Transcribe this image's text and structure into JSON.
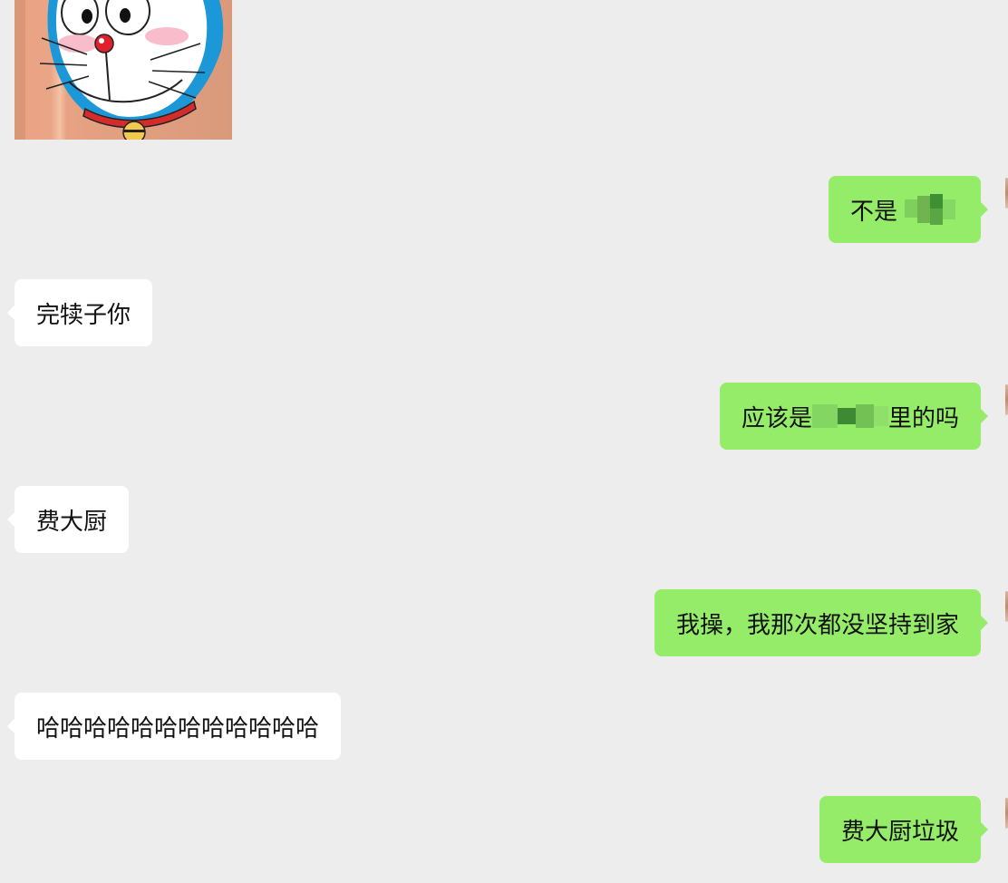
{
  "chat": {
    "sticker": {
      "alt": "doraemon-sticker"
    },
    "messages": [
      {
        "side": "right",
        "parts": [
          "不是",
          "[blurred]"
        ]
      },
      {
        "side": "left",
        "text": "完犊子你"
      },
      {
        "side": "right",
        "parts": [
          "应该是",
          "[blurred]",
          "里的吗"
        ]
      },
      {
        "side": "left",
        "text": "费大厨"
      },
      {
        "side": "right",
        "text": "我操，我那次都没坚持到家"
      },
      {
        "side": "left",
        "text": "哈哈哈哈哈哈哈哈哈哈哈哈"
      },
      {
        "side": "right",
        "text": "费大厨垃圾"
      }
    ]
  },
  "colors": {
    "background": "#ededed",
    "incoming_bubble": "#ffffff",
    "outgoing_bubble": "#95ec69",
    "text": "#111111"
  }
}
